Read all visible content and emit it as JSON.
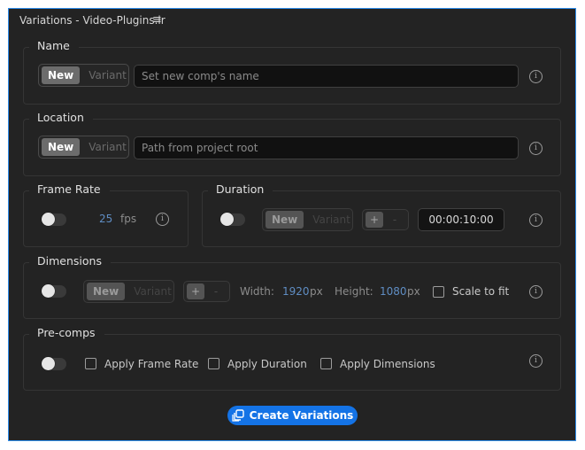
{
  "window": {
    "title": "Variations - Video-Plugins.ir",
    "menu_icon": "hamburger-menu-icon"
  },
  "name_section": {
    "label": "Name",
    "seg": {
      "on": "New",
      "off": "Variant"
    },
    "placeholder": "Set new comp's name",
    "info_icon": "info-icon"
  },
  "location_section": {
    "label": "Location",
    "seg": {
      "on": "New",
      "off": "Variant"
    },
    "placeholder": "Path from project root",
    "info_icon": "info-icon"
  },
  "frame_rate_section": {
    "label": "Frame Rate",
    "value": "25",
    "unit": "fps",
    "enabled": false
  },
  "duration_section": {
    "label": "Duration",
    "seg": {
      "on": "New",
      "off": "Variant"
    },
    "plus": "+",
    "minus": "-",
    "time": "00:00:10:00",
    "enabled": false
  },
  "dimensions_section": {
    "label": "Dimensions",
    "seg": {
      "on": "New",
      "off": "Variant"
    },
    "plus": "+",
    "minus": "-",
    "width_label": "Width:",
    "width_value": "1920",
    "width_unit": "px",
    "height_label": "Height:",
    "height_value": "1080",
    "height_unit": "px",
    "scale_label": "Scale to fit",
    "enabled": false
  },
  "precomps_section": {
    "label": "Pre-comps",
    "apply_frame_rate": "Apply Frame Rate",
    "apply_duration": "Apply Duration",
    "apply_dimensions": "Apply Dimensions",
    "enabled": false
  },
  "create_button": {
    "label": "Create Variations",
    "icon": "copy-stack-icon"
  },
  "colors": {
    "accent": "#1473e6",
    "border": "#2d8ceb",
    "panel_bg": "#232323",
    "value_blue": "#5f8dc3"
  }
}
